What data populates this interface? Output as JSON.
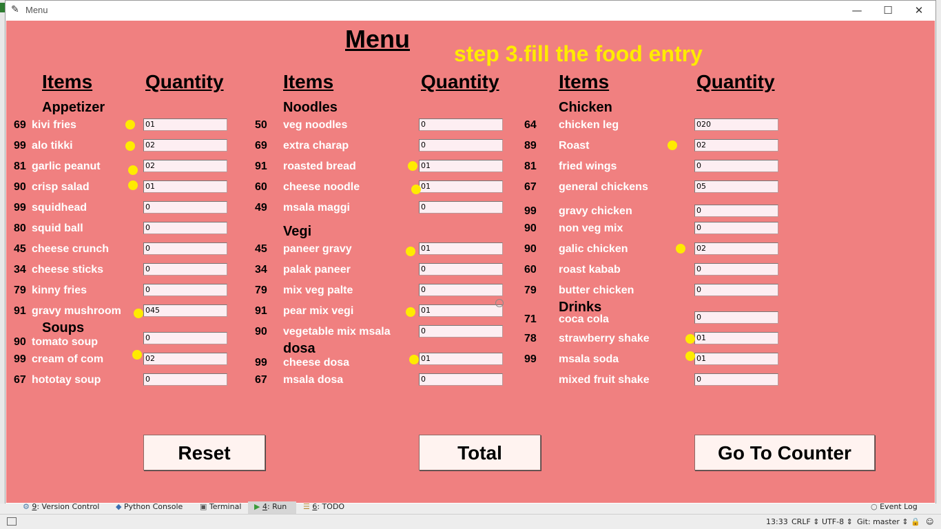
{
  "window": {
    "title": "Menu"
  },
  "heading": "Menu",
  "overlay_text": "step 3.fill the food entry",
  "columns": [
    {
      "items_header": "Items",
      "quantity_header": "Quantity"
    },
    {
      "items_header": "Items",
      "quantity_header": "Quantity"
    },
    {
      "items_header": "Items",
      "quantity_header": "Quantity"
    }
  ],
  "sections": {
    "appetizer": "Appetizer",
    "soups": "Soups",
    "noodles": "Noodles",
    "vegi": "Vegi",
    "dosa": "dosa",
    "chicken": "Chicken",
    "drinks": "Drinks"
  },
  "col1": [
    {
      "price": "69",
      "name": "kivi fries",
      "qty": "01"
    },
    {
      "price": "99",
      "name": "alo tikki",
      "qty": "02"
    },
    {
      "price": "81",
      "name": "garlic peanut",
      "qty": "02"
    },
    {
      "price": "90",
      "name": "crisp salad",
      "qty": "01"
    },
    {
      "price": "99",
      "name": "squidhead",
      "qty": "0"
    },
    {
      "price": "80",
      "name": "squid ball",
      "qty": "0"
    },
    {
      "price": "45",
      "name": "cheese crunch",
      "qty": "0"
    },
    {
      "price": "34",
      "name": "cheese sticks",
      "qty": "0"
    },
    {
      "price": "79",
      "name": "kinny fries",
      "qty": "0"
    },
    {
      "price": "91",
      "name": "gravy mushroom",
      "qty": "045"
    },
    {
      "price": "90",
      "name": "tomato soup",
      "qty": "0"
    },
    {
      "price": "99",
      "name": "cream of com",
      "qty": "02"
    },
    {
      "price": "67",
      "name": "hototay soup",
      "qty": "0"
    }
  ],
  "col2": [
    {
      "price": "50",
      "name": "veg noodles",
      "qty": "0"
    },
    {
      "price": "69",
      "name": "extra charap",
      "qty": "0"
    },
    {
      "price": "91",
      "name": "roasted bread",
      "qty": "01"
    },
    {
      "price": "60",
      "name": "cheese noodle",
      "qty": "01"
    },
    {
      "price": "49",
      "name": "msala maggi",
      "qty": "0"
    },
    {
      "price": "45",
      "name": "paneer gravy",
      "qty": "01"
    },
    {
      "price": "34",
      "name": "palak paneer",
      "qty": "0"
    },
    {
      "price": "79",
      "name": "mix veg palte",
      "qty": "0"
    },
    {
      "price": "91",
      "name": "pear mix vegi",
      "qty": "01"
    },
    {
      "price": "90",
      "name": "vegetable mix msala",
      "qty": "0"
    },
    {
      "price": "99",
      "name": "cheese dosa",
      "qty": "01"
    },
    {
      "price": "67",
      "name": "msala dosa",
      "qty": "0"
    }
  ],
  "col3": [
    {
      "price": "64",
      "name": "chicken leg",
      "qty": "020"
    },
    {
      "price": "89",
      "name": "Roast",
      "qty": "02"
    },
    {
      "price": "81",
      "name": "fried wings",
      "qty": "0"
    },
    {
      "price": "67",
      "name": "general chickens",
      "qty": "05"
    },
    {
      "price": "99",
      "name": "gravy chicken",
      "qty": "0"
    },
    {
      "price": "90",
      "name": "non veg mix",
      "qty": "0"
    },
    {
      "price": "90",
      "name": "galic chicken",
      "qty": "02"
    },
    {
      "price": "60",
      "name": "roast kabab",
      "qty": "0"
    },
    {
      "price": "79",
      "name": "butter chicken",
      "qty": "0"
    },
    {
      "price": "71",
      "name": "coca cola",
      "qty": "0"
    },
    {
      "price": "78",
      "name": "strawberry shake",
      "qty": "01"
    },
    {
      "price": "99",
      "name": "msala soda",
      "qty": "01"
    },
    {
      "price": "",
      "name": "mixed fruit shake",
      "qty": "0"
    }
  ],
  "buttons": {
    "reset": "Reset",
    "total": "Total",
    "counter": "Go To Counter"
  },
  "ide_tools": {
    "version_control_num": "9",
    "version_control": ": Version Control",
    "python_console": "Python Console",
    "terminal": "Terminal",
    "run_num": "4",
    "run": ": Run",
    "todo_num": "6",
    "todo": ": TODO",
    "event_log": "Event Log"
  },
  "status_bar": {
    "time": "13:33",
    "line_sep": "CRLF",
    "encoding": "UTF-8",
    "git": "Git: master"
  },
  "colors": {
    "canvas": "#f08080",
    "overlay_text": "#ffeb00",
    "dot": "#ffeb00"
  }
}
